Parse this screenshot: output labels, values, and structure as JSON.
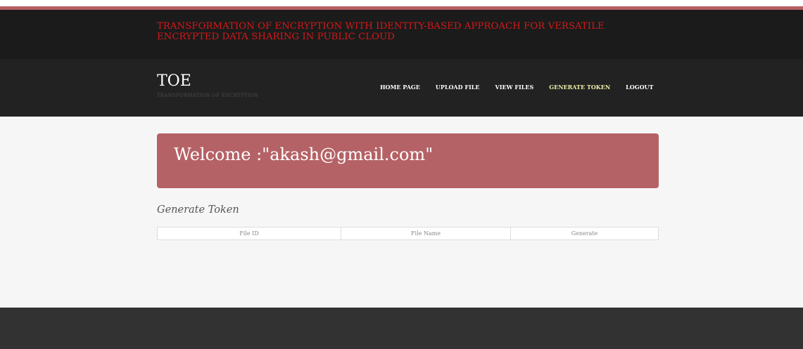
{
  "banner": {
    "title": "TRANSFORMATION OF ENCRYPTION WITH IDENTITY-BASED APPROACH FOR VERSATILE ENCRYPTED DATA SHARING IN PUBLIC CLOUD"
  },
  "brand": {
    "name": "TOE",
    "tagline": "TRANSFORMATION OF ENCRYPTION"
  },
  "nav": {
    "items": [
      {
        "label": "HOME PAGE",
        "active": false
      },
      {
        "label": "UPLOAD FILE",
        "active": false
      },
      {
        "label": "VIEW FILES",
        "active": false
      },
      {
        "label": "GENERATE TOKEN",
        "active": true
      },
      {
        "label": "LOGOUT",
        "active": false
      }
    ]
  },
  "welcome": {
    "text": "Welcome :\"akash@gmail.com\""
  },
  "section": {
    "title": "Generate Token"
  },
  "table": {
    "columns": [
      "File ID",
      "File Name",
      "Generate"
    ],
    "rows": []
  },
  "colors": {
    "banner_title": "#d61818",
    "accent_stripe": "#b55f62",
    "welcome_box": "#b56266",
    "active_nav": "#eeeeaa",
    "footer": "#323232"
  }
}
